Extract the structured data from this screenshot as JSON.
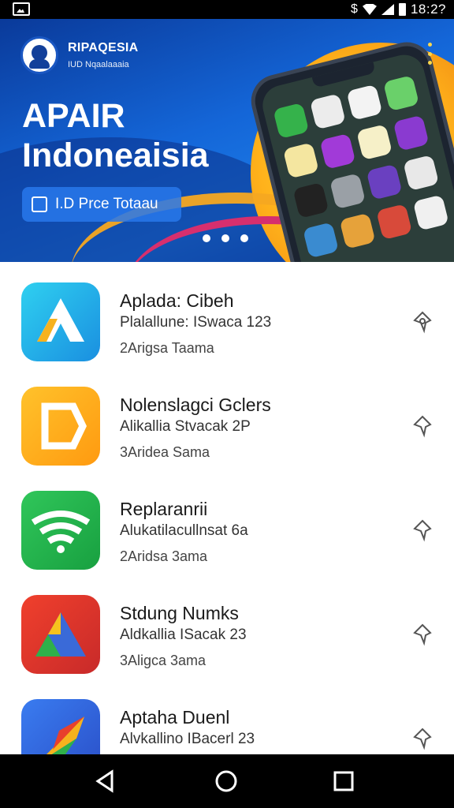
{
  "status_bar": {
    "time": "18:2?",
    "icons": [
      "gallery-icon",
      "dollar-icon",
      "wifi-icon",
      "signal-icon",
      "battery-icon"
    ],
    "dollar_symbol": "$"
  },
  "banner": {
    "brand_name": "RIPAQESIA",
    "brand_tagline": "IUD Nqaalaaaia",
    "title_line1": "APAIR",
    "title_line2": "Indoneaisia",
    "cta_label": "I.D Prce Totaau",
    "carousel_pages": 3,
    "colors": {
      "blue": "#1466d8",
      "orange": "#ffb21b",
      "pink": "#d62f6e"
    }
  },
  "apps": [
    {
      "title": "Aplada: Cibeh",
      "subtitle": "Plalallune: ISwaca 123",
      "meta": "2Arigsa Taama",
      "icon": "play-a-icon",
      "color": "#20b8e8"
    },
    {
      "title": "Nolenslagci Gclers",
      "subtitle": "Alikallia Stvacak 2P",
      "meta": "3Aridea Sama",
      "icon": "tag-icon",
      "color": "#ffb21b"
    },
    {
      "title": "Replaranrii",
      "subtitle": "Alukatilacullnsat 6a",
      "meta": "2Aridsa 3ama",
      "icon": "wifi-fan-icon",
      "color": "#23b24b"
    },
    {
      "title": "Stdung Numks",
      "subtitle": "Aldkallia ISacak 23",
      "meta": "3Aligca 3ama",
      "icon": "drive-triangle-icon",
      "color": "#e8352c"
    },
    {
      "title": "Aptaha Duenl",
      "subtitle": "Alvkallino IBacerl 23",
      "meta": "",
      "icon": "feather-icon",
      "color": "#2f6de0"
    }
  ],
  "nav": {
    "back": "back-icon",
    "home": "home-icon",
    "recents": "recents-icon"
  }
}
